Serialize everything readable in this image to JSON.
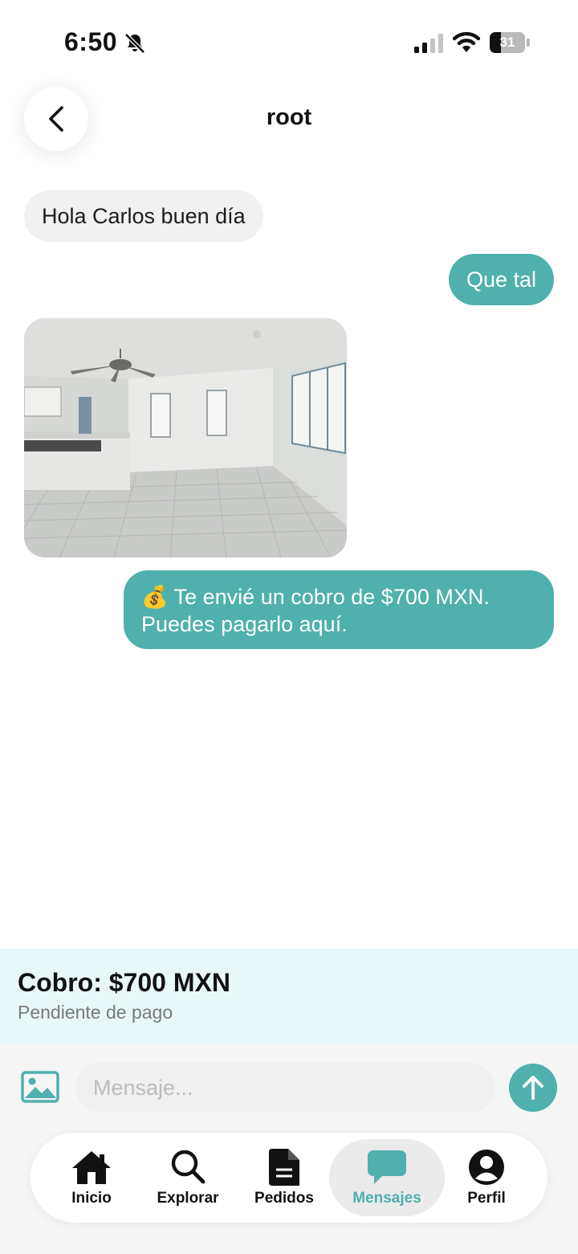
{
  "status_bar": {
    "time": "6:50",
    "battery": "31",
    "battery_level": 0.31
  },
  "header": {
    "title": "root"
  },
  "messages": [
    {
      "direction": "incoming",
      "type": "text",
      "text": "Hola Carlos buen día"
    },
    {
      "direction": "outgoing",
      "type": "text",
      "text": "Que tal"
    },
    {
      "direction": "incoming",
      "type": "image"
    },
    {
      "direction": "outgoing",
      "type": "text",
      "text": "💰 Te envié un cobro de $700 MXN. Puedes pagarlo aquí."
    }
  ],
  "charge": {
    "title": "Cobro: $700 MXN",
    "status": "Pendiente de pago"
  },
  "composer": {
    "placeholder": "Mensaje..."
  },
  "nav": {
    "items": [
      {
        "label": "Inicio",
        "icon": "home-icon"
      },
      {
        "label": "Explorar",
        "icon": "search-icon"
      },
      {
        "label": "Pedidos",
        "icon": "document-icon"
      },
      {
        "label": "Mensajes",
        "icon": "chat-bubble-icon",
        "active": true
      },
      {
        "label": "Perfil",
        "icon": "profile-icon"
      }
    ]
  },
  "colors": {
    "accent": "#4fb0ad",
    "incoming_bubble": "#f1f1f1",
    "banner_bg": "#e8f7f8"
  }
}
